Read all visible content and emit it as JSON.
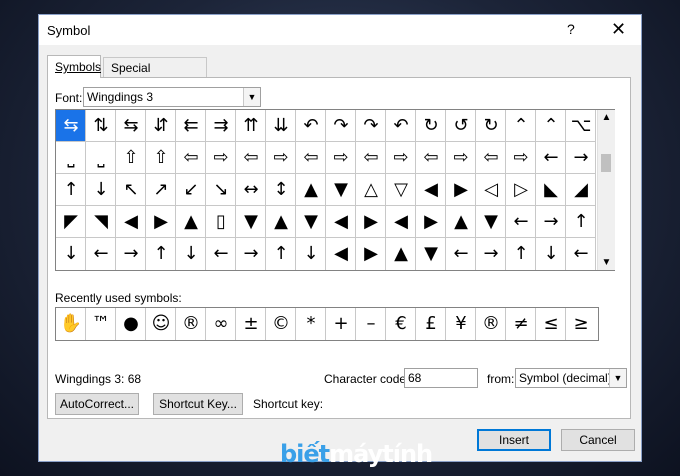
{
  "window": {
    "title": "Symbol",
    "help_glyph": "?",
    "close_glyph": "✕"
  },
  "tabs": [
    {
      "label": "Symbols"
    },
    {
      "label": "Special Characters"
    }
  ],
  "font": {
    "label": "Font:",
    "value": "Wingdings 3"
  },
  "grid": {
    "rows": [
      [
        "⇆",
        "⇅",
        "⇆",
        "⇵",
        "⇇",
        "⇉",
        "⇈",
        "⇊",
        "↶",
        "↷",
        "↷",
        "↶",
        "↻",
        "↺",
        "↻",
        "⌃",
        "⌃",
        "⌥"
      ],
      [
        "⎵",
        "⎵",
        "⇧",
        "⇧",
        "⇦",
        "⇨",
        "⇦",
        "⇨",
        "⇦",
        "⇨",
        "⇦",
        "⇨",
        "⇦",
        "⇨",
        "⇦",
        "⇨",
        "←",
        "→"
      ],
      [
        "↑",
        "↓",
        "↖",
        "↗",
        "↙",
        "↘",
        "↔",
        "↕",
        "▲",
        "▼",
        "△",
        "▽",
        "◀",
        "▶",
        "◁",
        "▷",
        "◣",
        "◢"
      ],
      [
        "◤",
        "◥",
        "◀",
        "▶",
        "▲",
        "▯",
        "▼",
        "▲",
        "▼",
        "◀",
        "▶",
        "◀",
        "▶",
        "▲",
        "▼",
        "←",
        "→",
        "↑"
      ],
      [
        "↓",
        "←",
        "→",
        "↑",
        "↓",
        "←",
        "→",
        "↑",
        "↓",
        "◀",
        "▶",
        "▲",
        "▼",
        "←",
        "→",
        "↑",
        "↓",
        "←"
      ]
    ]
  },
  "recent": {
    "label": "Recently used symbols:",
    "items": [
      "✋",
      "™",
      "●",
      "☺",
      "®",
      "∞",
      "±",
      "©",
      "*",
      "+",
      "–",
      "€",
      "£",
      "¥",
      "®",
      "≠",
      "≤",
      "≥"
    ]
  },
  "status": {
    "char_name": "Wingdings 3: 68"
  },
  "char_code": {
    "label": "Character code:",
    "value": "68"
  },
  "from": {
    "label": "from:",
    "value": "Symbol (decimal)"
  },
  "buttons": {
    "autocorrect": "AutoCorrect...",
    "shortcut_key": "Shortcut Key...",
    "shortcut_key_label": "Shortcut key:",
    "insert": "Insert",
    "cancel": "Cancel"
  },
  "watermark": {
    "part1": "biết",
    "part2": "máytính"
  },
  "colors": {
    "selection": "#1a73e8",
    "accent": "#0078d7"
  }
}
